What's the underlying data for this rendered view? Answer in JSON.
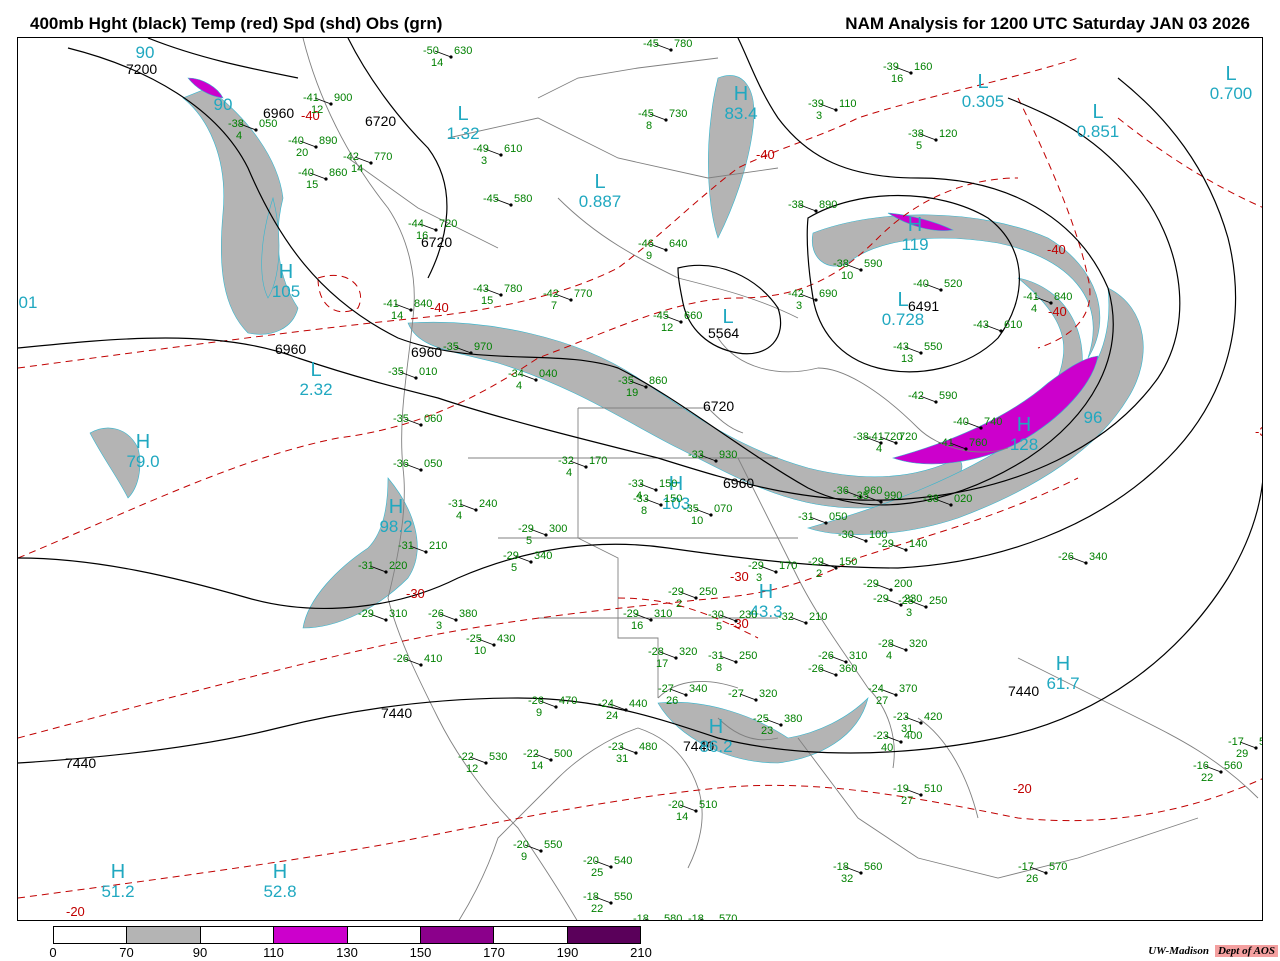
{
  "header": {
    "left_title": "400mb Hght (black) Temp (red) Spd (shd) Obs (grn)",
    "right_title": "NAM Analysis for 1200 UTC Saturday  JAN 03 2026"
  },
  "credit": {
    "org": "UW-Madison",
    "dept": "Dept of AOS"
  },
  "colors": {
    "height_contour": "#000000",
    "temp_contour": "#c00000",
    "speed_70_90": "#b4b4b4",
    "speed_110_130": "#cc00cc",
    "max_label": "#20a8c0",
    "obs": "#008000",
    "border": "#808080"
  },
  "legend": {
    "ticks": [
      "0",
      "70",
      "90",
      "110",
      "130",
      "150",
      "170",
      "190",
      "210"
    ],
    "colors": [
      "#ffffff",
      "#b4b4b4",
      "#ffffff",
      "#cc00cc",
      "#ffffff",
      "#8b008b",
      "#ffffff",
      "#5a005a"
    ]
  },
  "height_labels": [
    "7200",
    "6960",
    "6720",
    "6720",
    "6960",
    "6960",
    "6491",
    "5564",
    "6720",
    "6960",
    "7440",
    "7440",
    "7440",
    "7440"
  ],
  "temp_labels": [
    "-40",
    "-40",
    "-40",
    "-40",
    "-40",
    "-30",
    "-30",
    "-30",
    "-30",
    "-20",
    "-20"
  ],
  "centers": [
    {
      "letter": "L",
      "value": "0.305",
      "kind": "low"
    },
    {
      "letter": "L",
      "value": "0.700",
      "kind": "low"
    },
    {
      "letter": "L",
      "value": "0.851",
      "kind": "low"
    },
    {
      "letter": "L",
      "value": "1.32",
      "kind": "low"
    },
    {
      "letter": "L",
      "value": "0.887",
      "kind": "low"
    },
    {
      "letter": "L",
      "value": "2.32",
      "kind": "low"
    },
    {
      "letter": "L",
      "value": "0.728",
      "kind": "low"
    },
    {
      "letter": "L",
      "value": "",
      "kind": "low"
    },
    {
      "letter": "H",
      "value": "83.4",
      "kind": "high"
    },
    {
      "letter": "H",
      "value": "105",
      "kind": "high"
    },
    {
      "letter": "H",
      "value": "79.0",
      "kind": "high"
    },
    {
      "letter": "H",
      "value": "98.2",
      "kind": "high"
    },
    {
      "letter": "H",
      "value": "119",
      "kind": "high"
    },
    {
      "letter": "H",
      "value": "128",
      "kind": "high"
    },
    {
      "letter": "H",
      "value": "103",
      "kind": "high"
    },
    {
      "letter": "H",
      "value": "43.3",
      "kind": "high"
    },
    {
      "letter": "H",
      "value": "86.2",
      "kind": "high"
    },
    {
      "letter": "H",
      "value": "61.7",
      "kind": "high"
    },
    {
      "letter": "H",
      "value": "51.2",
      "kind": "high"
    },
    {
      "letter": "H",
      "value": "52.8",
      "kind": "high"
    },
    {
      "letter": "",
      "value": "90",
      "kind": "edge"
    },
    {
      "letter": "",
      "value": "90",
      "kind": "edge"
    },
    {
      "letter": "",
      "value": "01",
      "kind": "edge"
    },
    {
      "letter": "",
      "value": "96",
      "kind": "edge"
    }
  ],
  "observations": [
    {
      "temp": "-50",
      "hgt": "630",
      "dew": "14"
    },
    {
      "temp": "-45",
      "hgt": "780",
      "dew": ""
    },
    {
      "temp": "-39",
      "hgt": "160",
      "dew": "16"
    },
    {
      "temp": "-41",
      "hgt": "900",
      "dew": "12"
    },
    {
      "temp": "-38",
      "hgt": "050",
      "dew": "4"
    },
    {
      "temp": "-40",
      "hgt": "890",
      "dew": "20"
    },
    {
      "temp": "-42",
      "hgt": "770",
      "dew": "14"
    },
    {
      "temp": "-40",
      "hgt": "860",
      "dew": "15"
    },
    {
      "temp": "-45",
      "hgt": "730",
      "dew": "8"
    },
    {
      "temp": "-39",
      "hgt": "110",
      "dew": "3"
    },
    {
      "temp": "-38",
      "hgt": "120",
      "dew": "5"
    },
    {
      "temp": "-49",
      "hgt": "610",
      "dew": "3"
    },
    {
      "temp": "-45",
      "hgt": "580",
      "dew": ""
    },
    {
      "temp": "-38",
      "hgt": "890",
      "dew": ""
    },
    {
      "temp": "-44",
      "hgt": "720",
      "dew": "16"
    },
    {
      "temp": "-46",
      "hgt": "640",
      "dew": "9"
    },
    {
      "temp": "-38",
      "hgt": "590",
      "dew": "10"
    },
    {
      "temp": "-40",
      "hgt": "520",
      "dew": ""
    },
    {
      "temp": "-43",
      "hgt": "780",
      "dew": "15"
    },
    {
      "temp": "-42",
      "hgt": "770",
      "dew": "7"
    },
    {
      "temp": "-42",
      "hgt": "690",
      "dew": "3"
    },
    {
      "temp": "-41",
      "hgt": "840",
      "dew": "4"
    },
    {
      "temp": "-41",
      "hgt": "840",
      "dew": "14"
    },
    {
      "temp": "-45",
      "hgt": "660",
      "dew": "12"
    },
    {
      "temp": "-43",
      "hgt": "610",
      "dew": ""
    },
    {
      "temp": "-43",
      "hgt": "550",
      "dew": "13"
    },
    {
      "temp": "-35",
      "hgt": "970",
      "dew": ""
    },
    {
      "temp": "-35",
      "hgt": "010",
      "dew": ""
    },
    {
      "temp": "-34",
      "hgt": "040",
      "dew": "4"
    },
    {
      "temp": "-35",
      "hgt": "860",
      "dew": "19"
    },
    {
      "temp": "-42",
      "hgt": "590",
      "dew": ""
    },
    {
      "temp": "-40",
      "hgt": "740",
      "dew": ""
    },
    {
      "temp": "-41",
      "hgt": "720",
      "dew": "4"
    },
    {
      "temp": "-35",
      "hgt": "060",
      "dew": ""
    },
    {
      "temp": "-38",
      "hgt": "720",
      "dew": ""
    },
    {
      "temp": "-41",
      "hgt": "760",
      "dew": ""
    },
    {
      "temp": "-36",
      "hgt": "050",
      "dew": ""
    },
    {
      "temp": "-32",
      "hgt": "170",
      "dew": "4"
    },
    {
      "temp": "-33",
      "hgt": "930",
      "dew": ""
    },
    {
      "temp": "-33",
      "hgt": "150",
      "dew": "4"
    },
    {
      "temp": "-33",
      "hgt": "150",
      "dew": "8"
    },
    {
      "temp": "-35",
      "hgt": "070",
      "dew": "10"
    },
    {
      "temp": "-36",
      "hgt": "960",
      "dew": ""
    },
    {
      "temp": "-35",
      "hgt": "990",
      "dew": ""
    },
    {
      "temp": "-38",
      "hgt": "020",
      "dew": ""
    },
    {
      "temp": "-31",
      "hgt": "240",
      "dew": "4"
    },
    {
      "temp": "-31",
      "hgt": "210",
      "dew": ""
    },
    {
      "temp": "-31",
      "hgt": "220",
      "dew": ""
    },
    {
      "temp": "-29",
      "hgt": "300",
      "dew": "5"
    },
    {
      "temp": "-29",
      "hgt": "340",
      "dew": "5"
    },
    {
      "temp": "-31",
      "hgt": "050",
      "dew": ""
    },
    {
      "temp": "-30",
      "hgt": "100",
      "dew": ""
    },
    {
      "temp": "-29",
      "hgt": "140",
      "dew": ""
    },
    {
      "temp": "-29",
      "hgt": "170",
      "dew": "3"
    },
    {
      "temp": "-29",
      "hgt": "150",
      "dew": "2"
    },
    {
      "temp": "-29",
      "hgt": "250",
      "dew": "2"
    },
    {
      "temp": "-29",
      "hgt": "200",
      "dew": ""
    },
    {
      "temp": "-29",
      "hgt": "230",
      "dew": ""
    },
    {
      "temp": "-28",
      "hgt": "250",
      "dew": "3"
    },
    {
      "temp": "-26",
      "hgt": "340",
      "dew": ""
    },
    {
      "temp": "-29",
      "hgt": "310",
      "dew": ""
    },
    {
      "temp": "-26",
      "hgt": "380",
      "dew": "3"
    },
    {
      "temp": "-29",
      "hgt": "310",
      "dew": "16"
    },
    {
      "temp": "-30",
      "hgt": "230",
      "dew": "5"
    },
    {
      "temp": "-32",
      "hgt": "210",
      "dew": ""
    },
    {
      "temp": "-25",
      "hgt": "430",
      "dew": "10"
    },
    {
      "temp": "-26",
      "hgt": "410",
      "dew": ""
    },
    {
      "temp": "-28",
      "hgt": "320",
      "dew": "17"
    },
    {
      "temp": "-31",
      "hgt": "250",
      "dew": "8"
    },
    {
      "temp": "-28",
      "hgt": "320",
      "dew": "4"
    },
    {
      "temp": "-26",
      "hgt": "310",
      "dew": ""
    },
    {
      "temp": "-26",
      "hgt": "360",
      "dew": ""
    },
    {
      "temp": "-27",
      "hgt": "340",
      "dew": "26"
    },
    {
      "temp": "-27",
      "hgt": "320",
      "dew": ""
    },
    {
      "temp": "-24",
      "hgt": "370",
      "dew": "27"
    },
    {
      "temp": "-23",
      "hgt": "420",
      "dew": "31"
    },
    {
      "temp": "-23",
      "hgt": "400",
      "dew": "40"
    },
    {
      "temp": "-25",
      "hgt": "380",
      "dew": "23"
    },
    {
      "temp": "-26",
      "hgt": "470",
      "dew": "9"
    },
    {
      "temp": "-24",
      "hgt": "440",
      "dew": "24"
    },
    {
      "temp": "-23",
      "hgt": "480",
      "dew": "31"
    },
    {
      "temp": "-22",
      "hgt": "530",
      "dew": "12"
    },
    {
      "temp": "-22",
      "hgt": "500",
      "dew": "14"
    },
    {
      "temp": "-19",
      "hgt": "510",
      "dew": "27"
    },
    {
      "temp": "-20",
      "hgt": "510",
      "dew": "14"
    },
    {
      "temp": "-20",
      "hgt": "550",
      "dew": "9"
    },
    {
      "temp": "-20",
      "hgt": "540",
      "dew": "25"
    },
    {
      "temp": "-18",
      "hgt": "550",
      "dew": "22"
    },
    {
      "temp": "-18",
      "hgt": "580",
      "dew": ""
    },
    {
      "temp": "-18",
      "hgt": "570",
      "dew": ""
    },
    {
      "temp": "-18",
      "hgt": "560",
      "dew": "32"
    },
    {
      "temp": "-17",
      "hgt": "570",
      "dew": "26"
    },
    {
      "temp": "-16",
      "hgt": "560",
      "dew": "22"
    },
    {
      "temp": "-17",
      "hgt": "5",
      "dew": "29"
    }
  ]
}
